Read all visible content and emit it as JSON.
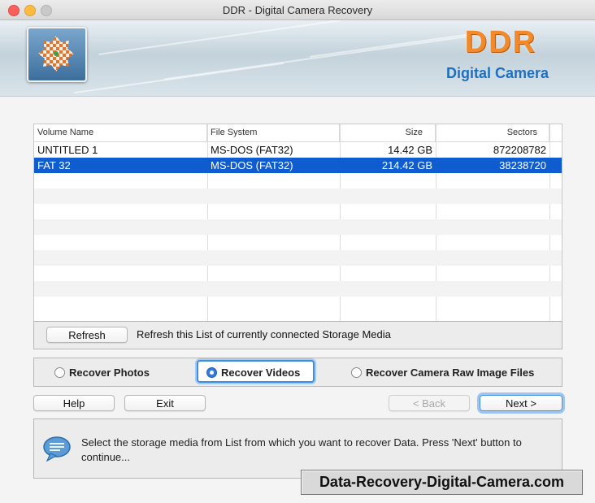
{
  "window": {
    "title": "DDR - Digital Camera Recovery"
  },
  "banner": {
    "brand": "DDR",
    "subtitle": "Digital Camera"
  },
  "table": {
    "columns": [
      "Volume Name",
      "File System",
      "Size",
      "Sectors"
    ],
    "rows": [
      {
        "volume": "UNTITLED 1",
        "fs": "MS-DOS (FAT32)",
        "size": "14.42  GB",
        "sectors": "872208782",
        "selected": false
      },
      {
        "volume": "FAT 32",
        "fs": "MS-DOS (FAT32)",
        "size": "214.42  GB",
        "sectors": "38238720",
        "selected": true
      }
    ]
  },
  "refresh": {
    "button_label": "Refresh",
    "description": "Refresh this List of currently connected Storage Media"
  },
  "recover_options": {
    "photos": "Recover Photos",
    "videos": "Recover Videos",
    "raw": "Recover Camera Raw Image Files",
    "selected": "videos"
  },
  "buttons": {
    "help": "Help",
    "exit": "Exit",
    "back": "< Back",
    "next": "Next >"
  },
  "info": {
    "message": "Select the storage media from List from which you want to recover Data. Press 'Next' button to continue..."
  },
  "watermark": "Data-Recovery-Digital-Camera.com",
  "colors": {
    "selection": "#0f5bd0",
    "brand": "#f28a2c",
    "subtitle": "#1f6fc0",
    "focus": "#3d8ee6"
  }
}
